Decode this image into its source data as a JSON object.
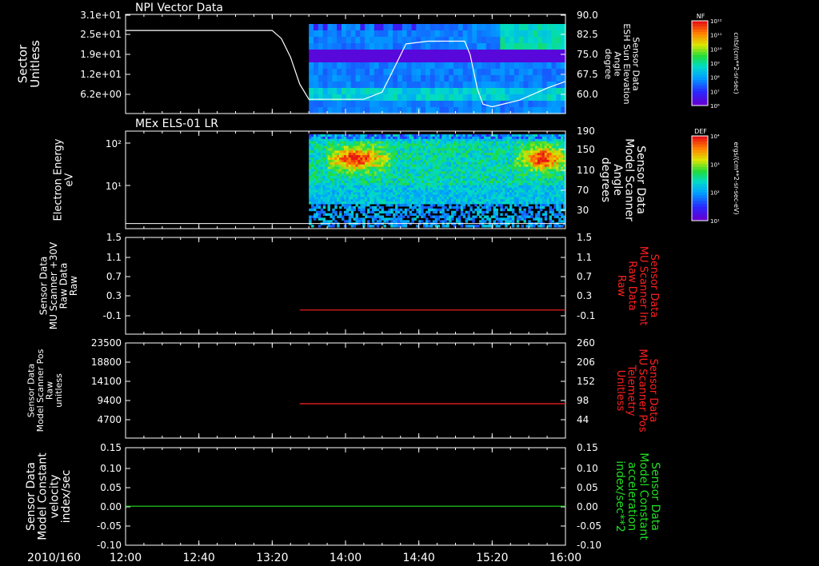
{
  "date_label": "2010/160",
  "x_ticks": [
    "12:00",
    "12:40",
    "13:20",
    "14:00",
    "14:40",
    "15:20",
    "16:00"
  ],
  "colors": {
    "background": "#000000",
    "axis": "#ffffff",
    "red_trace": "#ff2020",
    "green_trace": "#22dd22"
  },
  "chart_data": [
    {
      "type": "heatmap",
      "title": "NPI Vector Data",
      "ylabel_left": [
        "Sector",
        "Unitless"
      ],
      "yticks_left": [
        "3.1e+01",
        "2.5e+01",
        "1.9e+01",
        "1.2e+01",
        "6.2e+00"
      ],
      "ylabel_right": [
        "Sensor Data",
        "ESH Sun Elevation",
        "Angle",
        "degree"
      ],
      "yticks_right": [
        "90.0",
        "82.5",
        "75.0",
        "67.5",
        "60.0"
      ],
      "right_ylim": [
        53,
        90
      ],
      "colorbar_label": "NF",
      "colorbar_ticks": [
        "10¹²",
        "10¹¹",
        "10¹⁰",
        "10⁹",
        "10⁸",
        "10⁷",
        "10⁶"
      ],
      "colorbar_unit": "cnts/(cm**2-sr-sec)",
      "data_start": "13:40",
      "overlay_line": {
        "name": "ESH Sun Elevation Angle",
        "x": [
          "12:00",
          "12:20",
          "13:00",
          "13:20",
          "13:25",
          "13:30",
          "13:35",
          "13:40",
          "13:50",
          "14:10",
          "14:20",
          "14:28",
          "14:33",
          "14:45",
          "15:05",
          "15:08",
          "15:12",
          "15:15",
          "15:20",
          "15:35",
          "15:50",
          "16:00"
        ],
        "y": [
          84,
          84,
          84,
          84,
          81,
          74,
          64,
          58.3,
          58.3,
          58.3,
          61,
          72,
          79,
          80,
          80,
          75,
          62,
          56.5,
          55.5,
          58,
          62.5,
          65
        ]
      }
    },
    {
      "type": "heatmap",
      "title": "MEx ELS-01 LR",
      "ylabel_left": [
        "Electron Energy",
        "eV"
      ],
      "yticks_left": [
        "10²",
        "10¹"
      ],
      "ylabel_right": [
        "Sensor Data",
        "Model Scanner",
        "Angle",
        "degrees"
      ],
      "yticks_right": [
        "190",
        "150",
        "110",
        "70",
        "30"
      ],
      "right_ylim": [
        0,
        190
      ],
      "colorbar_label": "DEF",
      "colorbar_ticks": [
        "10⁴",
        "10³",
        "10²",
        "10¹"
      ],
      "colorbar_unit": "ergs/(cm**2-sr-sec-eV)",
      "data_start": "13:40",
      "overlay_line": {
        "name": "Model Scanner Angle",
        "x": [
          "12:00",
          "16:00"
        ],
        "y": [
          10,
          10
        ]
      }
    },
    {
      "type": "line",
      "ylabel_left": [
        "Sensor Data",
        "MU Scanner +30V",
        "Raw Data",
        "Raw"
      ],
      "yticks_left": [
        "1.5",
        "1.1",
        "0.7",
        "0.3",
        "-0.1"
      ],
      "ylabel_right": [
        "Sensor Data",
        "MU Scanner Int",
        "Raw Data",
        "Raw"
      ],
      "yticks_right": [
        "1.5",
        "1.1",
        "0.7",
        "0.3",
        "-0.1"
      ],
      "ylim": [
        -0.5,
        1.5
      ],
      "series": [
        {
          "x": [
            "13:35",
            "16:00"
          ],
          "y": [
            0.0,
            0.0
          ]
        }
      ]
    },
    {
      "type": "line",
      "ylabel_left": [
        "Sensor Data",
        "Model Scanner Pos",
        "Raw",
        "unitless"
      ],
      "yticks_left": [
        "23500",
        "18800",
        "14100",
        "9400",
        "4700"
      ],
      "ylabel_right": [
        "Sensor Data",
        "MU Scanner Pos",
        "Telemetry",
        "Unitless"
      ],
      "yticks_right": [
        "260",
        "206",
        "152",
        "98",
        "44"
      ],
      "ylim": [
        0,
        23500
      ],
      "series": [
        {
          "x": [
            "13:35",
            "16:00"
          ],
          "y": [
            8500,
            8500
          ]
        }
      ]
    },
    {
      "type": "line",
      "ylabel_left": [
        "Sensor Data",
        "Model Constant",
        "velocity",
        "index/sec"
      ],
      "yticks_left": [
        "0.15",
        "0.10",
        "0.05",
        "0.00",
        "-0.05",
        "-0.10"
      ],
      "ylabel_right": [
        "Sensor Data",
        "Model Constant",
        "acceleration",
        "index/sec**2"
      ],
      "yticks_right": [
        "0.15",
        "0.10",
        "0.05",
        "0.00",
        "-0.05",
        "-0.10"
      ],
      "ylim": [
        -0.1,
        0.15
      ],
      "series": [
        {
          "x": [
            "12:00",
            "16:00"
          ],
          "y": [
            0.0,
            0.0
          ]
        }
      ]
    }
  ]
}
